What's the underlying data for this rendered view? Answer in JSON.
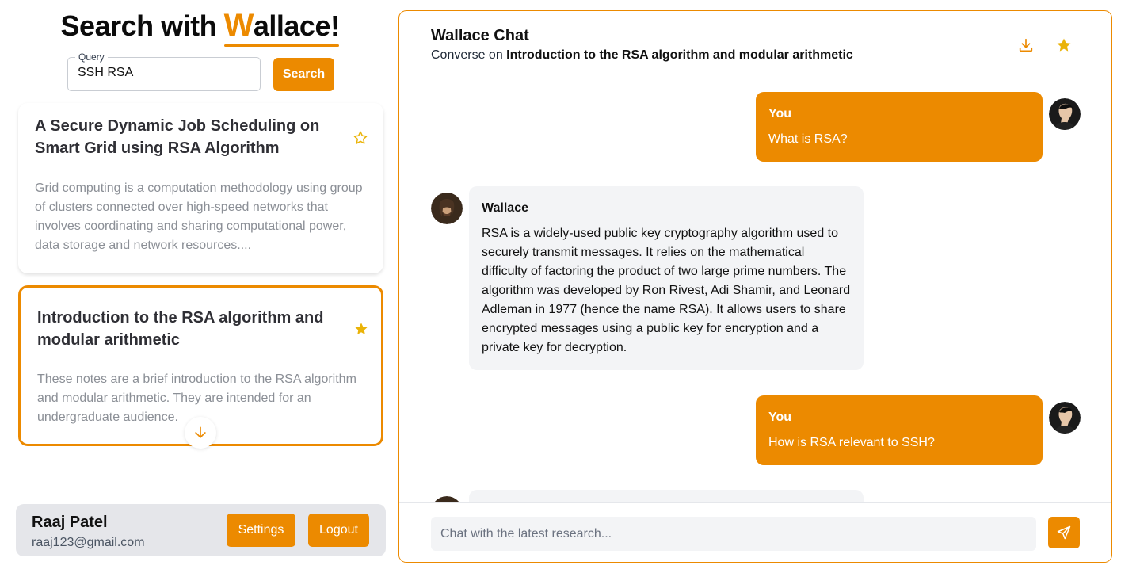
{
  "brand": {
    "prefix": "Search with ",
    "w": "W",
    "rest": "allace!"
  },
  "search": {
    "legend": "Query",
    "value": "SSH RSA",
    "button": "Search"
  },
  "results": [
    {
      "title": "A Secure Dynamic Job Scheduling on Smart Grid using RSA Algorithm",
      "snippet": "Grid computing is a computation methodology using group of clusters connected over high-speed networks that involves coordinating and sharing computational power, data storage and network resources....",
      "starred": false
    },
    {
      "title": "Introduction to the RSA algorithm and modular arithmetic",
      "snippet": "These notes are a brief introduction to the RSA algorithm and modular arithmetic. They are intended for an undergraduate audience.",
      "starred": true
    }
  ],
  "user": {
    "name": "Raaj Patel",
    "email": "raaj123@gmail.com",
    "settings": "Settings",
    "logout": "Logout"
  },
  "chat": {
    "title": "Wallace Chat",
    "subtitle_prefix": "Converse on ",
    "subtitle_topic": "Introduction to the RSA algorithm and modular arithmetic",
    "messages": [
      {
        "sender": "You",
        "text": "What is RSA?"
      },
      {
        "sender": "Wallace",
        "text": "RSA is a widely-used public key cryptography algorithm used to securely transmit messages. It relies on the mathematical difficulty of factoring the product of two large prime numbers. The algorithm was developed by Ron Rivest, Adi Shamir, and Leonard Adleman in 1977 (hence the name RSA). It allows users to share encrypted messages using a public key for encryption and a private key for decryption."
      },
      {
        "sender": "You",
        "text": "How is RSA relevant to SSH?"
      }
    ],
    "input_placeholder": "Chat with the latest research..."
  },
  "colors": {
    "accent": "#ec8a00",
    "star": "#eab308"
  },
  "icons": [
    "star-outline-icon",
    "star-filled-icon",
    "arrow-down-icon",
    "download-icon",
    "send-icon"
  ]
}
